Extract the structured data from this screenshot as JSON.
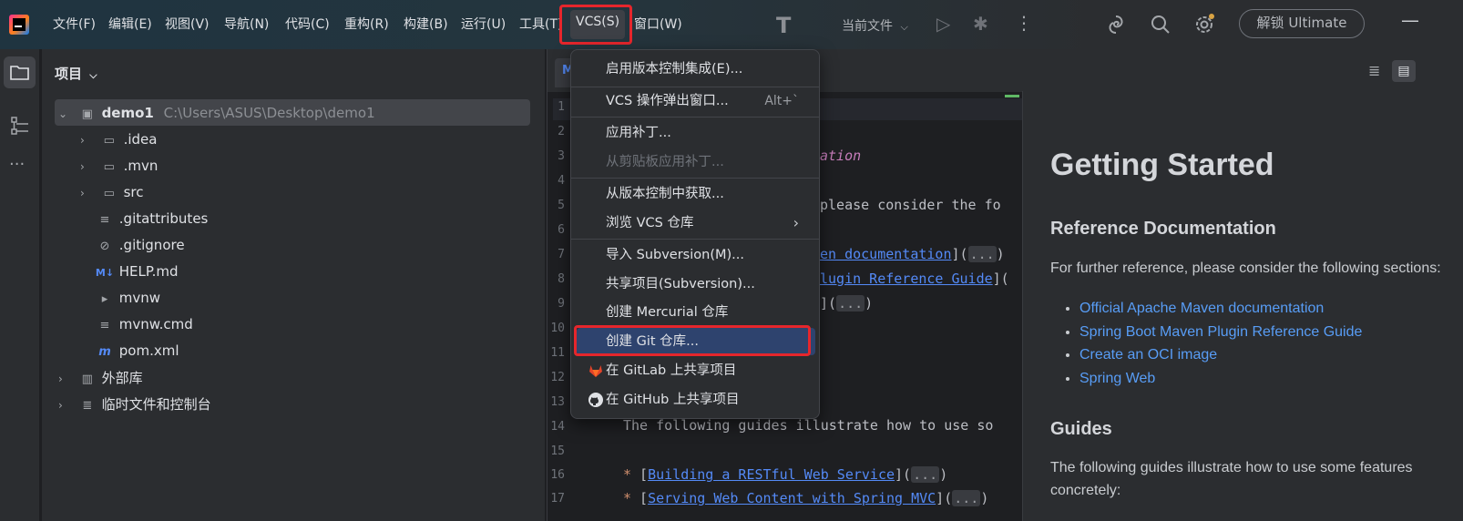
{
  "menubar": {
    "items": [
      "文件(F)",
      "编辑(E)",
      "视图(V)",
      "导航(N)",
      "代码(C)",
      "重构(R)",
      "构建(B)",
      "运行(U)",
      "工具(T)",
      "VCS(S)",
      "窗口(W)"
    ],
    "run_config": "当前文件",
    "unlock_label": "解锁 Ultimate"
  },
  "project_panel": {
    "title": "项目",
    "tree": [
      {
        "name": "demo1",
        "path": "C:\\Users\\ASUS\\Desktop\\demo1"
      },
      {
        "name": ".idea"
      },
      {
        "name": ".mvn"
      },
      {
        "name": "src"
      },
      {
        "name": ".gitattributes"
      },
      {
        "name": ".gitignore"
      },
      {
        "name": "HELP.md"
      },
      {
        "name": "mvnw"
      },
      {
        "name": "mvnw.cmd"
      },
      {
        "name": "pom.xml"
      },
      {
        "name": "外部库"
      },
      {
        "name": "临时文件和控制台"
      }
    ]
  },
  "vcs_menu": {
    "items": [
      {
        "label": "启用版本控制集成(E)..."
      },
      {
        "label": "VCS 操作弹出窗口...",
        "shortcut": "Alt+`"
      },
      {
        "label": "应用补丁..."
      },
      {
        "label": "从剪贴板应用补丁..."
      },
      {
        "label": "从版本控制中获取..."
      },
      {
        "label": "浏览 VCS 仓库"
      },
      {
        "label": "导入 Subversion(M)..."
      },
      {
        "label": "共享项目(Subversion)..."
      },
      {
        "label": "创建 Mercurial 仓库"
      },
      {
        "label": "创建 Git 仓库..."
      },
      {
        "label": "在 GitLab 上共享项目"
      },
      {
        "label": "在 GitHub 上共享项目"
      }
    ]
  },
  "editor": {
    "line_numbers": [
      "1",
      "2",
      "3",
      "4",
      "5",
      "6",
      "7",
      "8",
      "9",
      "10",
      "11",
      "12",
      "13",
      "14",
      "15",
      "16",
      "17"
    ],
    "visible_code": {
      "l3_tail": "ation",
      "l5_tail": " please consider the fo",
      "l7_tail": "en documentation",
      "l8_tail": "lugin Reference Guide",
      "l9_tail": "",
      "l14": "The following guides illustrate how to use so",
      "l16_link": "Building a RESTful Web Service",
      "l17_link": "Serving Web Content with Spring MVC",
      "fold": "..."
    }
  },
  "preview": {
    "h1": "Getting Started",
    "h2_ref": "Reference Documentation",
    "ref_text": "For further reference, please consider the following sections:",
    "links": [
      "Official Apache Maven documentation",
      "Spring Boot Maven Plugin Reference Guide",
      "Create an OCI image",
      "Spring Web"
    ],
    "h2_guides": "Guides",
    "guides_text_1": "The following guides illustrate how to use some features",
    "guides_text_2": "concretely:"
  }
}
